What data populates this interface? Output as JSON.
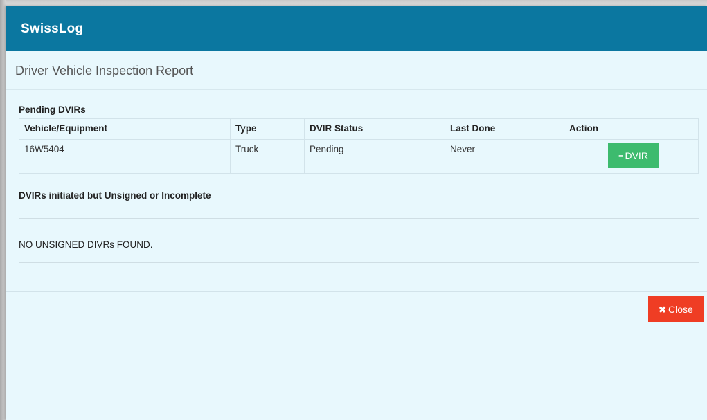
{
  "app": {
    "title": "SwissLog"
  },
  "report": {
    "title": "Driver Vehicle Inspection Report"
  },
  "pending": {
    "heading": "Pending DVIRs",
    "columns": [
      "Vehicle/Equipment",
      "Type",
      "DVIR Status",
      "Last Done",
      "Action"
    ],
    "rows": [
      {
        "vehicle": "16W5404",
        "type": "Truck",
        "status": "Pending",
        "last_done": "Never",
        "action_label": "DVIR"
      }
    ]
  },
  "unsigned": {
    "heading": "DVIRs initiated but Unsigned or Incomplete",
    "empty_message": "NO UNSIGNED DIVRs FOUND."
  },
  "footer": {
    "close_label": "Close"
  },
  "icons": {
    "dvir_icon": "list-icon",
    "close_icon": "times-icon"
  },
  "colors": {
    "header": "#0b77a0",
    "background": "#e8f8fd",
    "dvir_button": "#3dbb6e",
    "close_button": "#ef3d24"
  }
}
